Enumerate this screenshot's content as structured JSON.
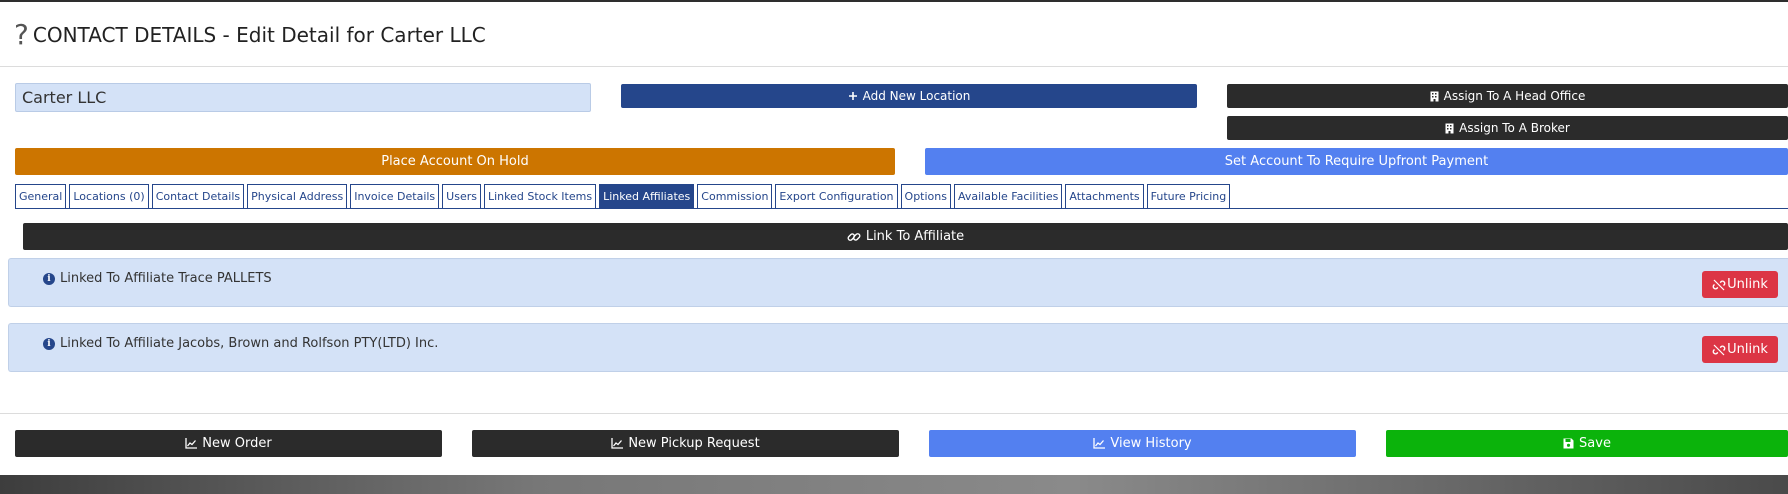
{
  "modal": {
    "title": "CONTACT DETAILS - Edit Detail for Carter LLC",
    "help_icon": "?"
  },
  "form": {
    "company_name": "Carter LLC"
  },
  "actions": {
    "add_location": "Add New Location",
    "assign_head_office": "Assign To A Head Office",
    "assign_broker": "Assign To A Broker",
    "place_on_hold": "Place Account On Hold",
    "require_upfront": "Set Account To Require Upfront Payment"
  },
  "tabs": [
    {
      "label": "General"
    },
    {
      "label": "Locations (0)"
    },
    {
      "label": "Contact Details"
    },
    {
      "label": "Physical Address"
    },
    {
      "label": "Invoice Details"
    },
    {
      "label": "Users"
    },
    {
      "label": "Linked Stock Items"
    },
    {
      "label": "Linked Affiliates",
      "active": true
    },
    {
      "label": "Commission"
    },
    {
      "label": "Export Configuration"
    },
    {
      "label": "Options"
    },
    {
      "label": "Available Facilities"
    },
    {
      "label": "Attachments"
    },
    {
      "label": "Future Pricing"
    }
  ],
  "linked_affiliates": {
    "link_button": "Link To Affiliate",
    "items": [
      {
        "text": "Linked To Affiliate Trace PALLETS",
        "unlink_label": "Unlink"
      },
      {
        "text": "Linked To Affiliate Jacobs, Brown and Rolfson PTY(LTD) Inc.",
        "unlink_label": "Unlink"
      }
    ]
  },
  "footer": {
    "new_order": "New Order",
    "new_pickup": "New Pickup Request",
    "view_history": "View History",
    "save": "Save"
  },
  "colors": {
    "navy": "#25468b",
    "dark": "#2b2b2b",
    "orange": "#cc7500",
    "blue": "#5380f0",
    "green": "#0bb30b",
    "red": "#dc3545",
    "light_blue_bg": "#d4e2f7"
  },
  "icons": {
    "add": "plus-icon",
    "building": "building-icon",
    "link": "link-icon",
    "unlink": "unlink-icon",
    "info": "info-circle-icon",
    "chart": "line-chart-icon",
    "save": "floppy-disk-icon"
  }
}
